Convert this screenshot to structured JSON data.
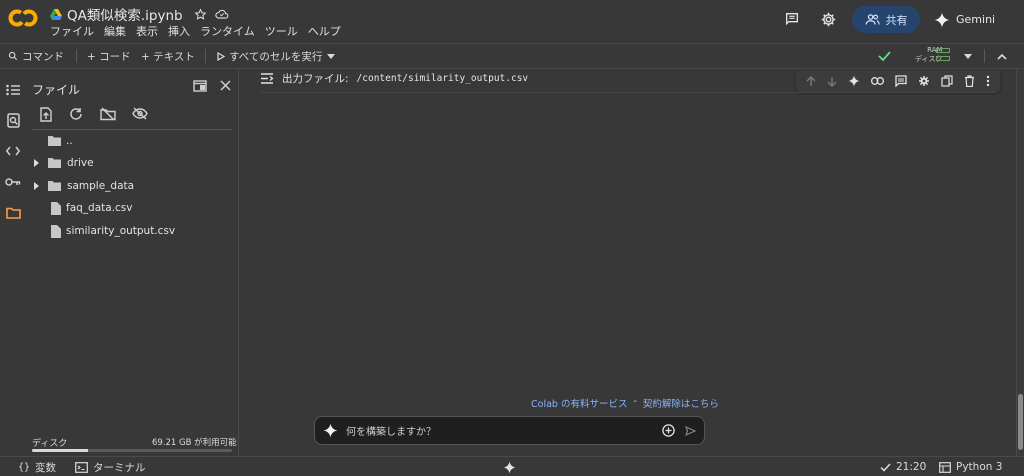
{
  "header": {
    "title": "QA類似検索.ipynb",
    "menu": [
      "ファイル",
      "編集",
      "表示",
      "挿入",
      "ランタイム",
      "ツール",
      "ヘルプ"
    ],
    "share_label": "共有",
    "gemini_label": "Gemini"
  },
  "toolbar": {
    "command_label": "コマンド",
    "add_code_label": "+ コード",
    "add_text_label": "+ テキスト",
    "run_all_label": "すべてのセルを実行",
    "ram_label": "RAM",
    "disk_label": "ディスク"
  },
  "file_panel": {
    "title": "ファイル",
    "tree": [
      {
        "name": "..",
        "kind": "parent"
      },
      {
        "name": "drive",
        "kind": "folder"
      },
      {
        "name": "sample_data",
        "kind": "folder"
      },
      {
        "name": "faq_data.csv",
        "kind": "file"
      },
      {
        "name": "similarity_output.csv",
        "kind": "file"
      }
    ],
    "disk_label": "ディスク",
    "disk_free": "69.21 GB が利用可能",
    "disk_used_fraction": 0.28
  },
  "main": {
    "output_label": "出力ファイル:",
    "output_path": "/content/similarity_output.csv",
    "promo_link1": "Colab の有料サービス",
    "promo_sep": "-",
    "promo_link2": "契約解除はこちら",
    "prompt_placeholder": "何を構築しますか？"
  },
  "statusbar": {
    "variables_label": "変数",
    "terminal_label": "ターミナル",
    "time": "21:20",
    "runtime": "Python 3"
  },
  "colors": {
    "background": "#383838",
    "accent_blue": "#8ab4f8",
    "share_bg": "#25456e",
    "check_green": "#6dd58c",
    "folder_icon": "#c4c7c5",
    "files_active": "#f5a24b",
    "logo_orange": "#f9ab00"
  }
}
